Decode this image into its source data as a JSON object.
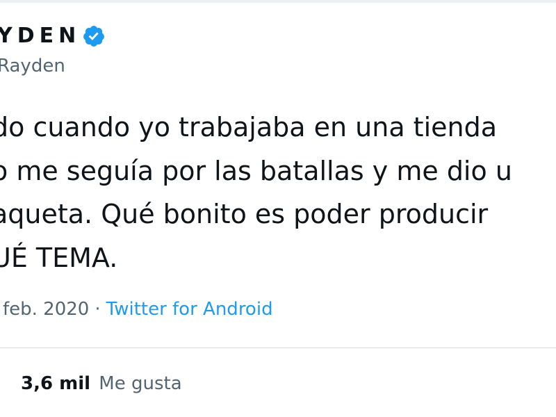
{
  "tweet": {
    "author": {
      "display_name": "YDEN",
      "handle": "Rayden",
      "verified_icon": "verified-badge-icon"
    },
    "text_lines": [
      "do cuando yo trabajaba en una tienda",
      "o me seguía por las batallas y me dio u",
      "aqueta. Qué bonito es poder producir",
      "UÉ TEMA."
    ],
    "date": "feb. 2020",
    "separator": "·",
    "source": "Twitter for Android",
    "likes": {
      "count": "3,6 mil",
      "label": "Me gusta"
    }
  },
  "colors": {
    "accent": "#1d9bf0",
    "muted": "#536471",
    "text": "#0f1419"
  }
}
